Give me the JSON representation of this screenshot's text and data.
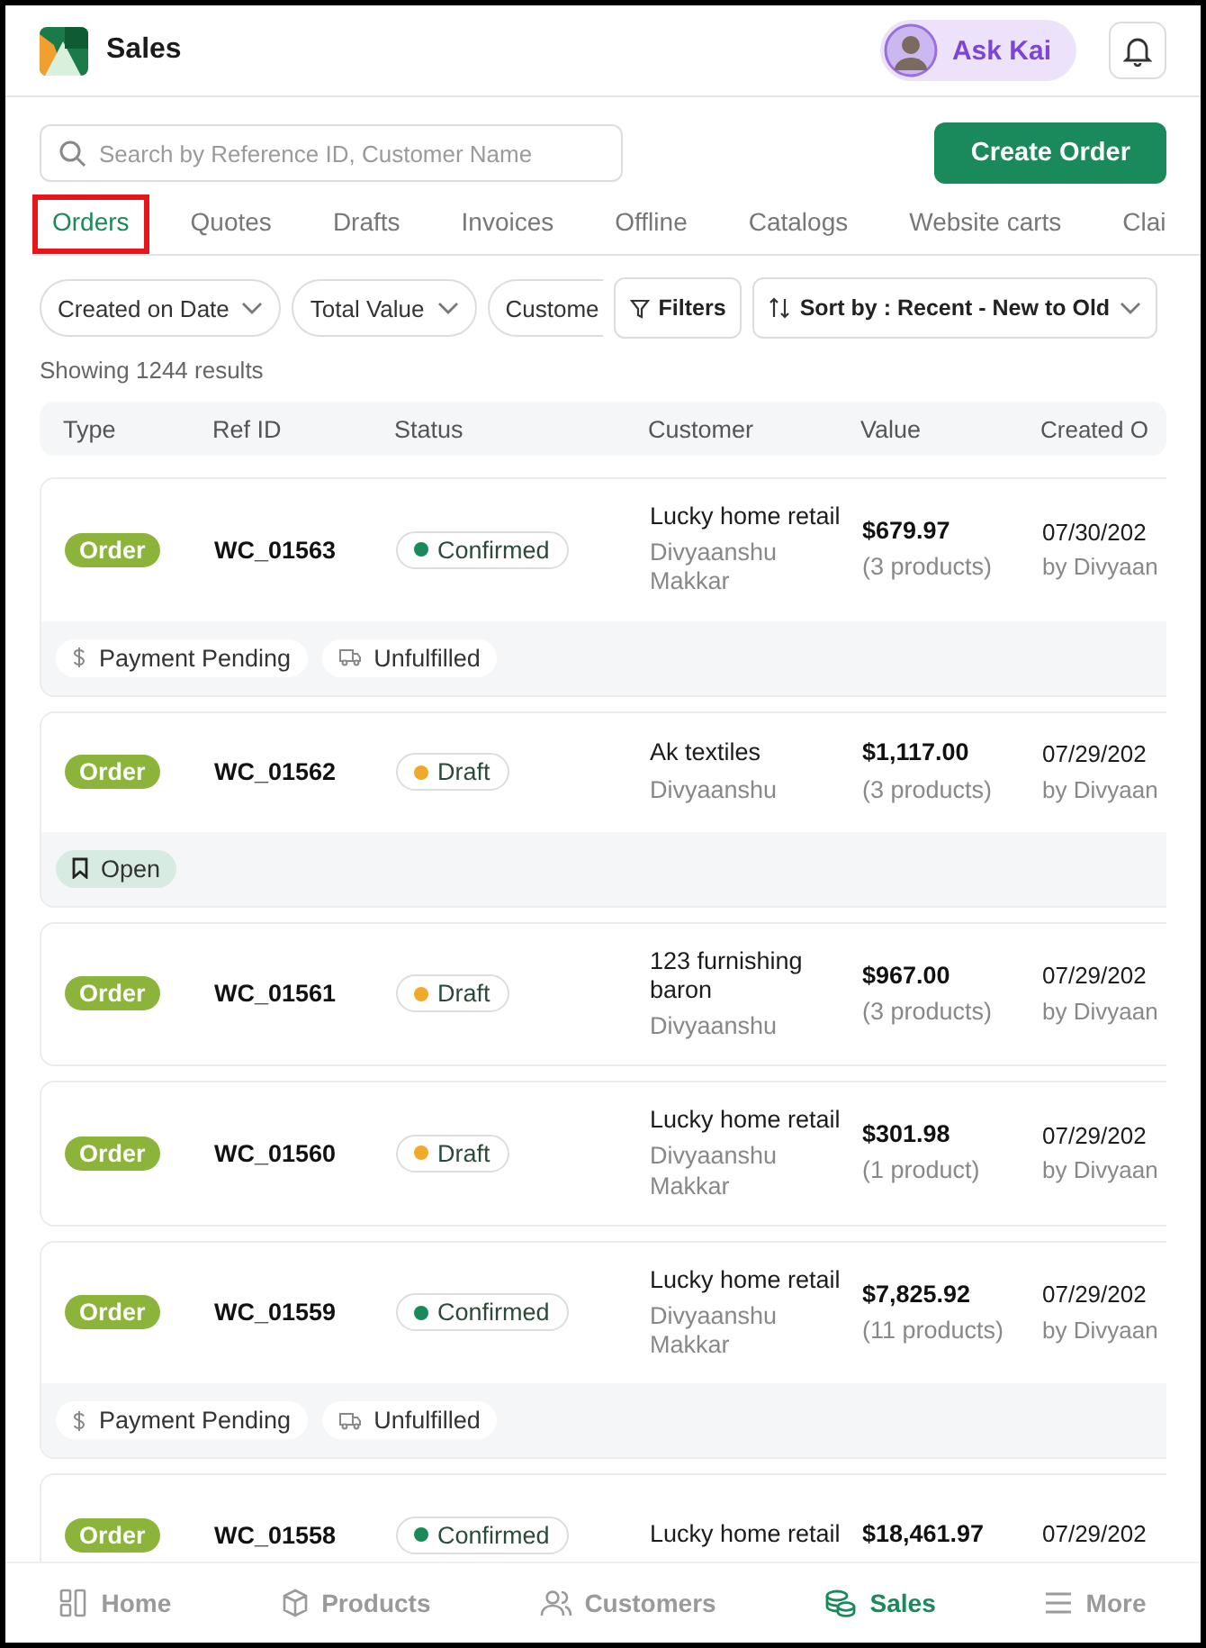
{
  "header": {
    "title": "Sales",
    "assistant": "Ask Kai"
  },
  "search": {
    "placeholder": "Search by Reference ID, Customer Name"
  },
  "create_button": "Create Order",
  "tabs": [
    {
      "label": "Orders",
      "selected": true,
      "highlighted": true
    },
    {
      "label": "Quotes",
      "selected": false,
      "highlighted": false
    },
    {
      "label": "Drafts",
      "selected": false,
      "highlighted": false
    },
    {
      "label": "Invoices",
      "selected": false,
      "highlighted": false
    },
    {
      "label": "Offline",
      "selected": false,
      "highlighted": false
    },
    {
      "label": "Catalogs",
      "selected": false,
      "highlighted": false
    },
    {
      "label": "Website carts",
      "selected": false,
      "highlighted": false
    },
    {
      "label": "Clai",
      "selected": false,
      "highlighted": false
    }
  ],
  "filters": [
    {
      "label": "Created on Date",
      "cut": false
    },
    {
      "label": "Total Value",
      "cut": false
    },
    {
      "label": "Custome",
      "cut": true
    }
  ],
  "filters_button": "Filters",
  "sort_button": "Sort by : Recent - New to Old",
  "results": "Showing 1244 results",
  "columns": [
    "Type",
    "Ref ID",
    "Status",
    "Customer",
    "Value",
    "Created O"
  ],
  "orders": [
    {
      "type": "Order",
      "ref_id": "WC_01563",
      "status": {
        "label": "Confirmed",
        "color": "#1a8a5a"
      },
      "customer": "Lucky home retail",
      "contact": "Divyaanshu Makkar",
      "value": "$679.97",
      "products": "(3 products)",
      "date": "07/30/202",
      "by": "by Divyaan",
      "tags": [
        {
          "kind": "payment",
          "label": "Payment Pending"
        },
        {
          "kind": "fulfillment",
          "label": "Unfulfilled"
        }
      ]
    },
    {
      "type": "Order",
      "ref_id": "WC_01562",
      "status": {
        "label": "Draft",
        "color": "#f0a92a"
      },
      "customer": "Ak textiles",
      "contact": "Divyaanshu",
      "value": "$1,117.00",
      "products": "(3 products)",
      "date": "07/29/202",
      "by": "by Divyaan",
      "tags": [
        {
          "kind": "open",
          "label": "Open"
        }
      ]
    },
    {
      "type": "Order",
      "ref_id": "WC_01561",
      "status": {
        "label": "Draft",
        "color": "#f0a92a"
      },
      "customer": "123 furnishing baron",
      "contact": "Divyaanshu",
      "value": "$967.00",
      "products": "(3 products)",
      "date": "07/29/202",
      "by": "by Divyaan"
    },
    {
      "type": "Order",
      "ref_id": "WC_01560",
      "status": {
        "label": "Draft",
        "color": "#f0a92a"
      },
      "customer": "Lucky home retail",
      "contact": "Divyaanshu Makkar",
      "value": "$301.98",
      "products": "(1 product)",
      "date": "07/29/202",
      "by": "by Divyaan"
    },
    {
      "type": "Order",
      "ref_id": "WC_01559",
      "status": {
        "label": "Confirmed",
        "color": "#1a8a5a"
      },
      "customer": "Lucky home retail",
      "contact": "Divyaanshu Makkar",
      "value": "$7,825.92",
      "products": "(11 products)",
      "date": "07/29/202",
      "by": "by Divyaan",
      "tags": [
        {
          "kind": "payment",
          "label": "Payment Pending"
        },
        {
          "kind": "fulfillment",
          "label": "Unfulfilled"
        }
      ]
    },
    {
      "type": "Order",
      "ref_id": "WC_01558",
      "status": {
        "label": "Confirmed",
        "color": "#1a8a5a"
      },
      "customer": "Lucky home retail",
      "value": "$18,461.97",
      "date": "07/29/202"
    }
  ],
  "nav": [
    {
      "kind": "home",
      "label": "Home",
      "selected": false
    },
    {
      "kind": "products",
      "label": "Products",
      "selected": false
    },
    {
      "kind": "customers",
      "label": "Customers",
      "selected": false
    },
    {
      "kind": "sales",
      "label": "Sales",
      "selected": true
    },
    {
      "kind": "more",
      "label": "More",
      "selected": false
    }
  ]
}
